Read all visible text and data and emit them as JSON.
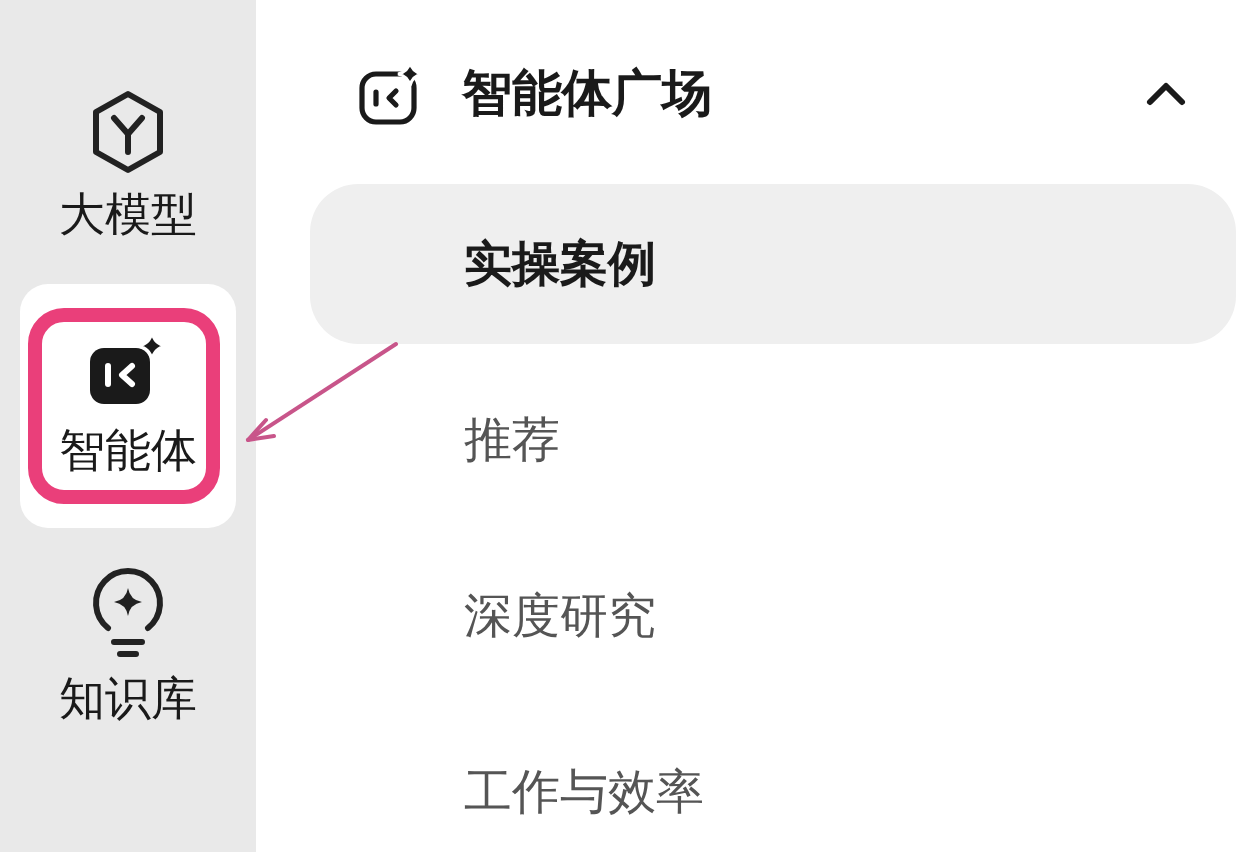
{
  "sidebar": {
    "items": [
      {
        "kind": "model",
        "label": "大模型",
        "selected": false,
        "annotated": false
      },
      {
        "kind": "agent",
        "label": "智能体",
        "selected": true,
        "annotated": true
      },
      {
        "kind": "knowledge",
        "label": "知识库",
        "selected": false,
        "annotated": false
      }
    ]
  },
  "section": {
    "title": "智能体广场",
    "expanded": true,
    "items": [
      {
        "label": "实操案例",
        "selected": true
      },
      {
        "label": "推荐",
        "selected": false
      },
      {
        "label": "深度研究",
        "selected": false
      },
      {
        "label": "工作与效率",
        "selected": false
      }
    ]
  }
}
